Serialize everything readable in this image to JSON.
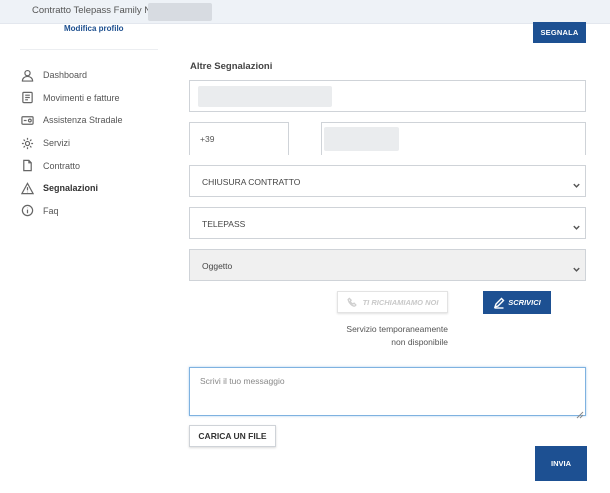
{
  "topbar": {
    "contract_label": "Contratto Telepass Family N° 2"
  },
  "profile": {
    "edit_label": "Modifica profilo"
  },
  "nav": {
    "items": [
      {
        "label": "Dashboard",
        "icon": "user-icon"
      },
      {
        "label": "Movimenti e fatture",
        "icon": "receipt-icon"
      },
      {
        "label": "Assistenza Stradale",
        "icon": "road-assistance-icon"
      },
      {
        "label": "Servizi",
        "icon": "gear-icon"
      },
      {
        "label": "Contratto",
        "icon": "document-icon"
      },
      {
        "label": "Segnalazioni",
        "icon": "warning-icon",
        "active": true
      },
      {
        "label": "Faq",
        "icon": "info-icon"
      }
    ]
  },
  "header": {
    "signal_label": "SEGNALA"
  },
  "form": {
    "title": "Altre Segnalazioni",
    "phone_prefix": "+39",
    "select_reason": "CHIUSURA CONTRATTO",
    "select_product": "TELEPASS",
    "select_subject": "Oggetto",
    "callback_label": "TI RICHIAMIAMO NOI",
    "write_label": "SCRIVICI",
    "unavailable_line1": "Servizio temporaneamente",
    "unavailable_line2": "non disponibile",
    "message_placeholder": "Scrivi il tuo messaggio",
    "upload_label": "CARICA UN FILE",
    "send_label": "INVIA"
  },
  "colors": {
    "accent": "#1d5092",
    "topbar": "#eef2f7",
    "focus": "#7fb2e0"
  }
}
